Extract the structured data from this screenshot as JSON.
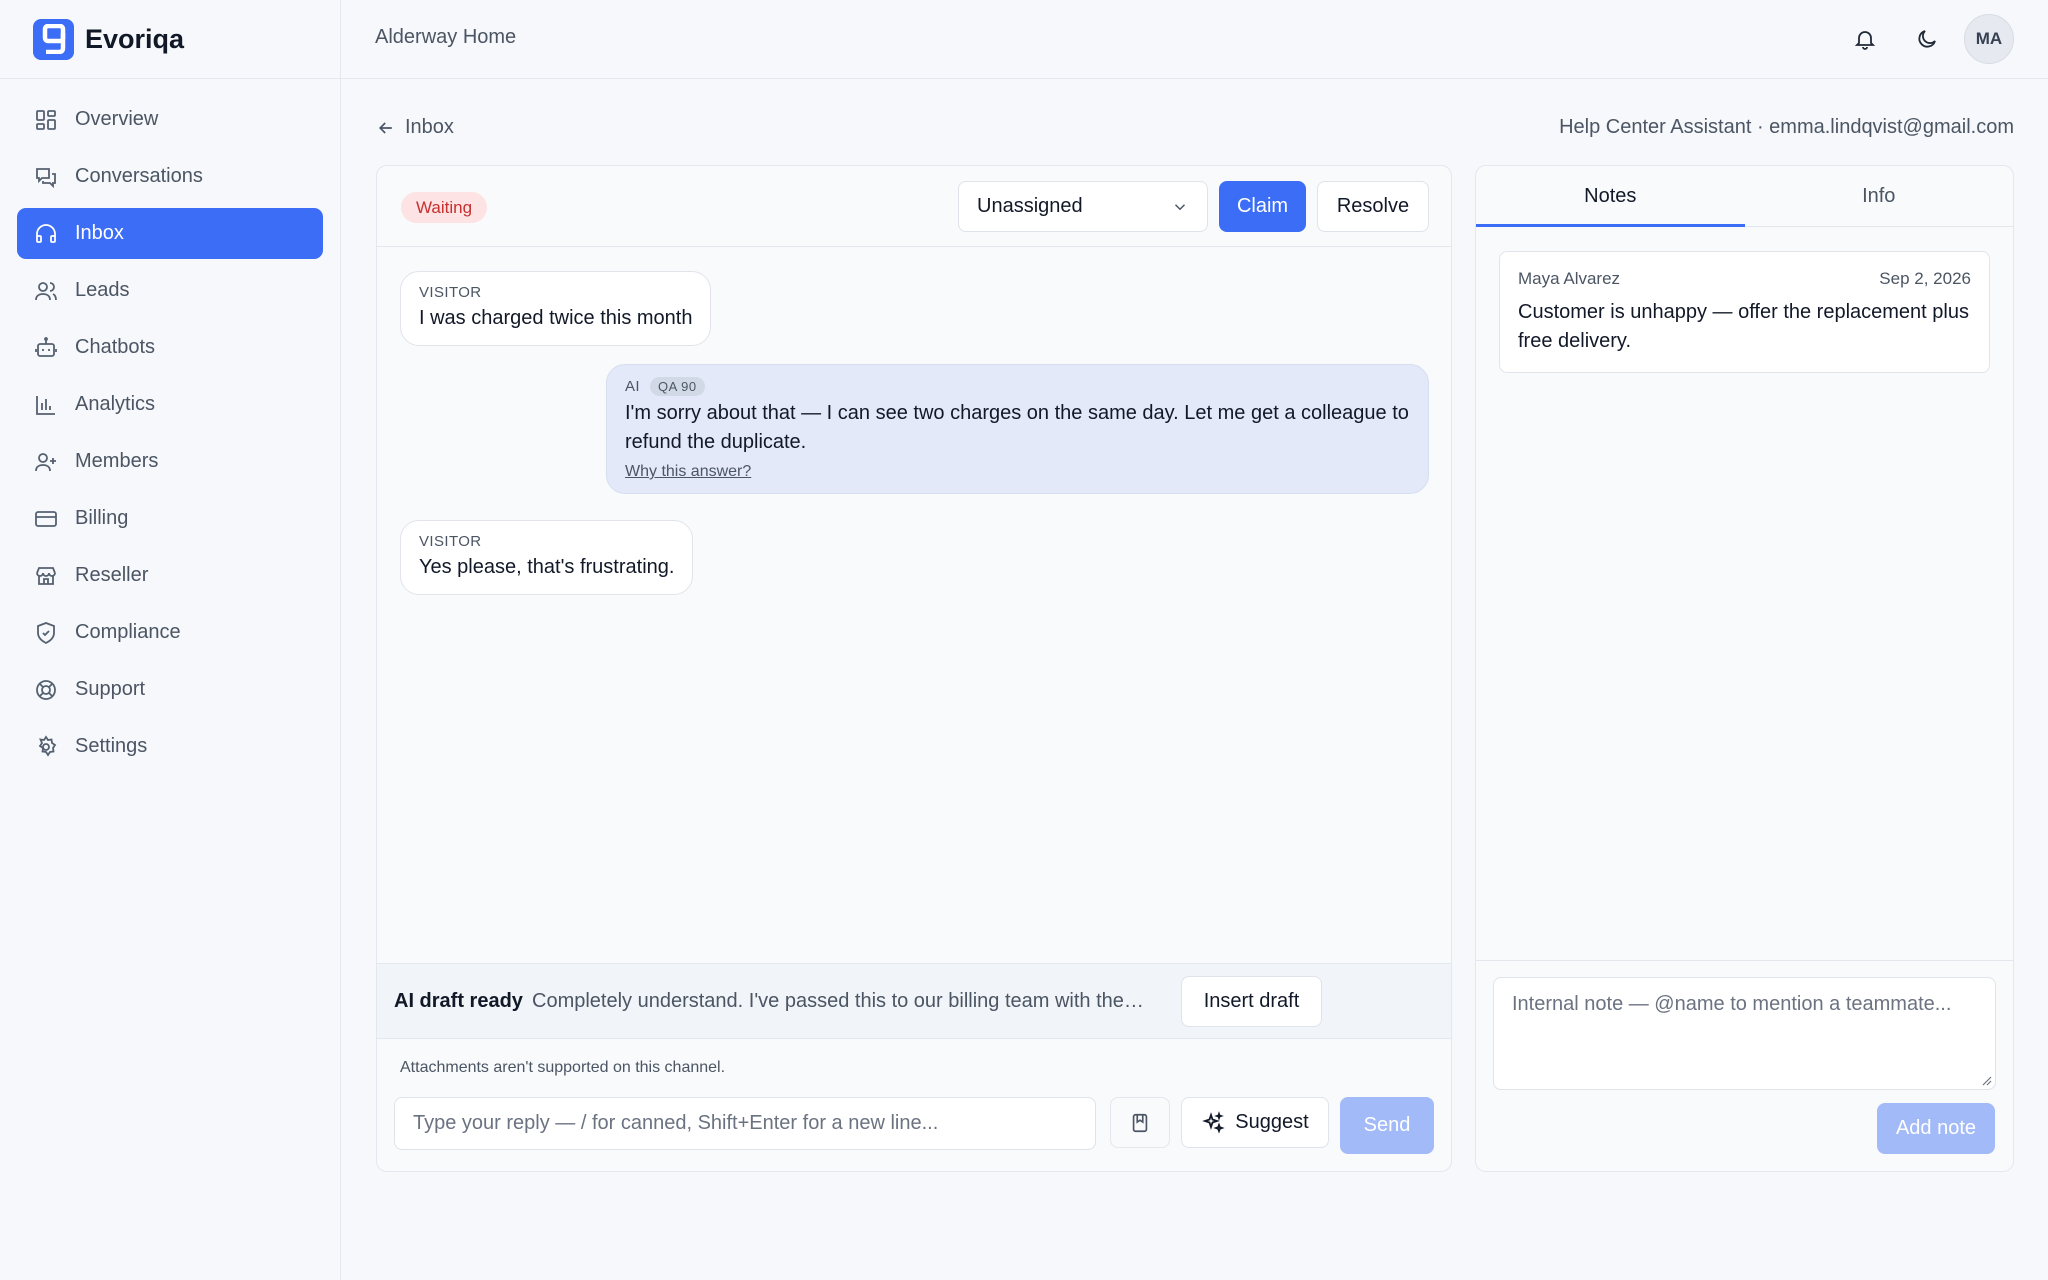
{
  "brand": {
    "name": "Evoriqa",
    "accent": "#3b6df6"
  },
  "sidebar": {
    "items": [
      {
        "label": "Overview",
        "icon": "grid-icon"
      },
      {
        "label": "Conversations",
        "icon": "chat-icon"
      },
      {
        "label": "Inbox",
        "icon": "headset-icon",
        "active": true
      },
      {
        "label": "Leads",
        "icon": "users-icon"
      },
      {
        "label": "Chatbots",
        "icon": "bot-icon"
      },
      {
        "label": "Analytics",
        "icon": "bar-chart-icon"
      },
      {
        "label": "Members",
        "icon": "user-plus-icon"
      },
      {
        "label": "Billing",
        "icon": "credit-card-icon"
      },
      {
        "label": "Reseller",
        "icon": "store-icon"
      },
      {
        "label": "Compliance",
        "icon": "shield-icon"
      },
      {
        "label": "Support",
        "icon": "lifebuoy-icon"
      },
      {
        "label": "Settings",
        "icon": "gear-icon"
      }
    ]
  },
  "topbar": {
    "workspace": "Alderway Home",
    "avatar_initials": "MA"
  },
  "page": {
    "back_label": "Inbox",
    "assistant_info": "Help Center Assistant · emma.lindqvist@gmail.com"
  },
  "conversation": {
    "status": "Waiting",
    "assignee": "Unassigned",
    "claim_label": "Claim",
    "resolve_label": "Resolve",
    "messages": [
      {
        "role": "VISITOR",
        "text": "I was charged twice this month"
      },
      {
        "role": "AI",
        "qa": "QA 90",
        "text": "I'm sorry about that — I can see two charges on the same day. Let me get a colleague to refund the duplicate.",
        "why_label": "Why this answer?"
      },
      {
        "role": "VISITOR",
        "text": "Yes please, that's frustrating."
      }
    ],
    "draft": {
      "title": "AI draft ready",
      "preview": "Completely understand. I've passed this to our billing team with the t...",
      "insert_label": "Insert draft"
    },
    "attachments_note": "Attachments aren't supported on this channel.",
    "reply_placeholder": "Type your reply — / for canned, Shift+Enter for a new line...",
    "suggest_label": "Suggest",
    "send_label": "Send"
  },
  "notes_panel": {
    "tabs": [
      {
        "label": "Notes",
        "active": true
      },
      {
        "label": "Info"
      }
    ],
    "notes": [
      {
        "author": "Maya Alvarez",
        "date": "Sep 2, 2026",
        "text": "Customer is unhappy — offer the replacement plus free delivery."
      }
    ],
    "note_placeholder": "Internal note — @name to mention a teammate...",
    "add_note_label": "Add note"
  }
}
